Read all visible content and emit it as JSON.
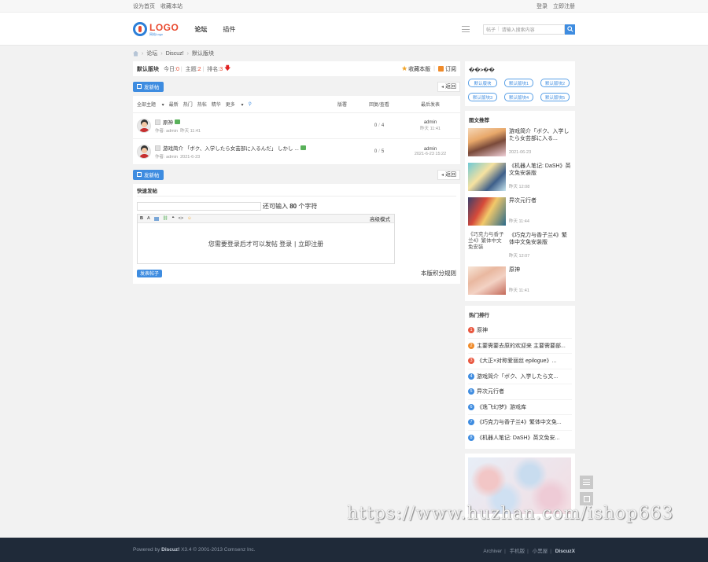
{
  "topbar": {
    "set_home": "设为首页",
    "favorite": "收藏本站",
    "login": "登录",
    "register": "立即注册"
  },
  "header": {
    "logo_text": "LOGO",
    "logo_sub": "网站Logo",
    "nav": [
      {
        "label": "论坛"
      },
      {
        "label": "插件"
      }
    ],
    "search_scope": "帖子",
    "search_placeholder": "请输入搜索内容"
  },
  "breadcrumb": [
    "论坛",
    "Discuz!",
    "默认版块"
  ],
  "forum": {
    "title": "默认版块",
    "today_label": "今日:",
    "today": "0",
    "topics_label": "主题:",
    "topics": "2",
    "rank_label": "排名:",
    "rank": "3",
    "favorite": "收藏本版",
    "subscribe": "订阅"
  },
  "actions": {
    "post": "发新帖",
    "back": "返回"
  },
  "filter": {
    "items": [
      "全部主题",
      "最新",
      "热门",
      "热帖",
      "精华",
      "更多"
    ],
    "cols": [
      "版署",
      "回复/查看",
      "最后发表"
    ]
  },
  "threads": [
    {
      "title": "原神",
      "author_label": "作者:",
      "author": "admin",
      "date": "昨天 11:41",
      "replies": "0",
      "views": "4",
      "last_user": "admin",
      "last_time": "昨天 11:41"
    },
    {
      "title": "游戏简介 「ボク、入学したら女芸部に入るんだ」 しかし ...",
      "author_label": "作者:",
      "author": "admin",
      "date": "2021-6-23",
      "replies": "0",
      "views": "5",
      "last_user": "admin",
      "last_time": "2021-6-23 15:22"
    }
  ],
  "quick_post": {
    "title": "快速发帖",
    "hint_pre": "还可输入",
    "hint_num": "80",
    "hint_post": "个字符",
    "toolbar": [
      "B",
      "A",
      "image",
      "link",
      "quote",
      "code",
      "smile"
    ],
    "mode": "高级模式",
    "login_msg": "您需要登录后才可以发帖",
    "login": "登录",
    "bar": "|",
    "register": "立即注册",
    "submit": "发表帖子",
    "rules": "本版积分规则"
  },
  "sidebar": {
    "sub_title": "��>��",
    "subforums": [
      "默认版块",
      "默认版块1",
      "默认版块2",
      "默认版块3",
      "默认版块4",
      "默认版块5"
    ],
    "pics_title": "图文推荐",
    "pics": [
      {
        "title": "游戏简介「ボク、入学したら女芸部に入る...",
        "date": "2021-06-23"
      },
      {
        "title": "《机器人笔记: DaSH》英文免安装版",
        "date": "昨天 12:08"
      },
      {
        "title": "异次元行者",
        "date": "昨天 11:44"
      },
      {
        "title": "《巧克力与香子兰4》繁体中文免安装版",
        "date": "昨天 12:07",
        "alt": "《巧克力与香子兰4》繁体中文免安装"
      },
      {
        "title": "原神",
        "date": "昨天 11:41"
      }
    ],
    "hot_title": "热门排行",
    "hot": [
      {
        "num": "1",
        "title": "原神"
      },
      {
        "num": "2",
        "title": "主要需要去原的欢迎来 主要需要部..."
      },
      {
        "num": "3",
        "title": "《大正×对称爱丽丝 epilogue》..."
      },
      {
        "num": "4",
        "title": "游戏简介「ボク、入学したら文..."
      },
      {
        "num": "5",
        "title": "异次元行者"
      },
      {
        "num": "6",
        "title": "《逸飞幻梦》游戏库"
      },
      {
        "num": "7",
        "title": "《巧克力与香子兰4》繁体中文免..."
      },
      {
        "num": "8",
        "title": "《机器人笔记: DaSH》英文免安..."
      }
    ]
  },
  "colors": {
    "accent": "#3e8ce0",
    "footer_bg": "#1f2a39",
    "hot_1": "#e9573f",
    "hot_2": "#f08b2a",
    "hot_rest": "#3e8ce0"
  },
  "watermark": "https://www.huzhan.com/ishop663",
  "footer": {
    "powered": "Powered by",
    "brand": "Discuz!",
    "version": "X3.4",
    "copy": "© 2001-2013 Comsenz Inc.",
    "links": [
      "Archiver",
      "手机版",
      "小黑屋"
    ],
    "brand2": "DiscuzX"
  }
}
